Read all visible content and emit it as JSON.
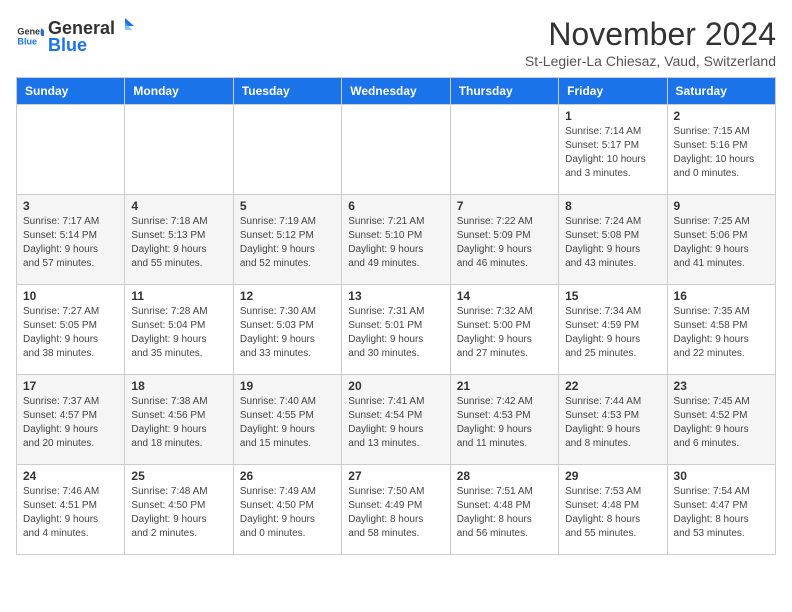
{
  "header": {
    "logo_general": "General",
    "logo_blue": "Blue",
    "month_title": "November 2024",
    "location": "St-Legier-La Chiesaz, Vaud, Switzerland"
  },
  "days_of_week": [
    "Sunday",
    "Monday",
    "Tuesday",
    "Wednesday",
    "Thursday",
    "Friday",
    "Saturday"
  ],
  "weeks": [
    [
      {
        "day": "",
        "info": ""
      },
      {
        "day": "",
        "info": ""
      },
      {
        "day": "",
        "info": ""
      },
      {
        "day": "",
        "info": ""
      },
      {
        "day": "",
        "info": ""
      },
      {
        "day": "1",
        "info": "Sunrise: 7:14 AM\nSunset: 5:17 PM\nDaylight: 10 hours\nand 3 minutes."
      },
      {
        "day": "2",
        "info": "Sunrise: 7:15 AM\nSunset: 5:16 PM\nDaylight: 10 hours\nand 0 minutes."
      }
    ],
    [
      {
        "day": "3",
        "info": "Sunrise: 7:17 AM\nSunset: 5:14 PM\nDaylight: 9 hours\nand 57 minutes."
      },
      {
        "day": "4",
        "info": "Sunrise: 7:18 AM\nSunset: 5:13 PM\nDaylight: 9 hours\nand 55 minutes."
      },
      {
        "day": "5",
        "info": "Sunrise: 7:19 AM\nSunset: 5:12 PM\nDaylight: 9 hours\nand 52 minutes."
      },
      {
        "day": "6",
        "info": "Sunrise: 7:21 AM\nSunset: 5:10 PM\nDaylight: 9 hours\nand 49 minutes."
      },
      {
        "day": "7",
        "info": "Sunrise: 7:22 AM\nSunset: 5:09 PM\nDaylight: 9 hours\nand 46 minutes."
      },
      {
        "day": "8",
        "info": "Sunrise: 7:24 AM\nSunset: 5:08 PM\nDaylight: 9 hours\nand 43 minutes."
      },
      {
        "day": "9",
        "info": "Sunrise: 7:25 AM\nSunset: 5:06 PM\nDaylight: 9 hours\nand 41 minutes."
      }
    ],
    [
      {
        "day": "10",
        "info": "Sunrise: 7:27 AM\nSunset: 5:05 PM\nDaylight: 9 hours\nand 38 minutes."
      },
      {
        "day": "11",
        "info": "Sunrise: 7:28 AM\nSunset: 5:04 PM\nDaylight: 9 hours\nand 35 minutes."
      },
      {
        "day": "12",
        "info": "Sunrise: 7:30 AM\nSunset: 5:03 PM\nDaylight: 9 hours\nand 33 minutes."
      },
      {
        "day": "13",
        "info": "Sunrise: 7:31 AM\nSunset: 5:01 PM\nDaylight: 9 hours\nand 30 minutes."
      },
      {
        "day": "14",
        "info": "Sunrise: 7:32 AM\nSunset: 5:00 PM\nDaylight: 9 hours\nand 27 minutes."
      },
      {
        "day": "15",
        "info": "Sunrise: 7:34 AM\nSunset: 4:59 PM\nDaylight: 9 hours\nand 25 minutes."
      },
      {
        "day": "16",
        "info": "Sunrise: 7:35 AM\nSunset: 4:58 PM\nDaylight: 9 hours\nand 22 minutes."
      }
    ],
    [
      {
        "day": "17",
        "info": "Sunrise: 7:37 AM\nSunset: 4:57 PM\nDaylight: 9 hours\nand 20 minutes."
      },
      {
        "day": "18",
        "info": "Sunrise: 7:38 AM\nSunset: 4:56 PM\nDaylight: 9 hours\nand 18 minutes."
      },
      {
        "day": "19",
        "info": "Sunrise: 7:40 AM\nSunset: 4:55 PM\nDaylight: 9 hours\nand 15 minutes."
      },
      {
        "day": "20",
        "info": "Sunrise: 7:41 AM\nSunset: 4:54 PM\nDaylight: 9 hours\nand 13 minutes."
      },
      {
        "day": "21",
        "info": "Sunrise: 7:42 AM\nSunset: 4:53 PM\nDaylight: 9 hours\nand 11 minutes."
      },
      {
        "day": "22",
        "info": "Sunrise: 7:44 AM\nSunset: 4:53 PM\nDaylight: 9 hours\nand 8 minutes."
      },
      {
        "day": "23",
        "info": "Sunrise: 7:45 AM\nSunset: 4:52 PM\nDaylight: 9 hours\nand 6 minutes."
      }
    ],
    [
      {
        "day": "24",
        "info": "Sunrise: 7:46 AM\nSunset: 4:51 PM\nDaylight: 9 hours\nand 4 minutes."
      },
      {
        "day": "25",
        "info": "Sunrise: 7:48 AM\nSunset: 4:50 PM\nDaylight: 9 hours\nand 2 minutes."
      },
      {
        "day": "26",
        "info": "Sunrise: 7:49 AM\nSunset: 4:50 PM\nDaylight: 9 hours\nand 0 minutes."
      },
      {
        "day": "27",
        "info": "Sunrise: 7:50 AM\nSunset: 4:49 PM\nDaylight: 8 hours\nand 58 minutes."
      },
      {
        "day": "28",
        "info": "Sunrise: 7:51 AM\nSunset: 4:48 PM\nDaylight: 8 hours\nand 56 minutes."
      },
      {
        "day": "29",
        "info": "Sunrise: 7:53 AM\nSunset: 4:48 PM\nDaylight: 8 hours\nand 55 minutes."
      },
      {
        "day": "30",
        "info": "Sunrise: 7:54 AM\nSunset: 4:47 PM\nDaylight: 8 hours\nand 53 minutes."
      }
    ]
  ]
}
